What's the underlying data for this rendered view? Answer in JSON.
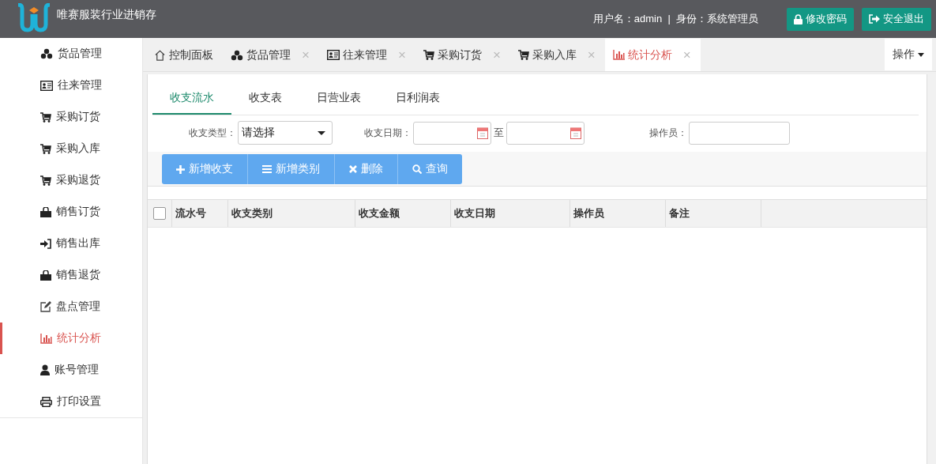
{
  "header": {
    "app_title": "唯赛服装行业进销存",
    "user_info": "用户名：admin  |  身份：系统管理员",
    "buttons": [
      {
        "kind": "lock",
        "label": "修改密码"
      },
      {
        "kind": "logout",
        "label": "安全退出"
      }
    ]
  },
  "sidebar": {
    "items": [
      {
        "kind": "cubes",
        "label": "货品管理",
        "selected": false
      },
      {
        "kind": "card",
        "label": "往来管理",
        "selected": false
      },
      {
        "kind": "cart",
        "label": "采购订货",
        "selected": false
      },
      {
        "kind": "cart",
        "label": "采购入库",
        "selected": false
      },
      {
        "kind": "cart",
        "label": "采购退货",
        "selected": false
      },
      {
        "kind": "bag",
        "label": "销售订货",
        "selected": false
      },
      {
        "kind": "signin",
        "label": "销售出库",
        "selected": false
      },
      {
        "kind": "bag",
        "label": "销售退货",
        "selected": false
      },
      {
        "kind": "edit",
        "label": "盘点管理",
        "selected": false
      },
      {
        "kind": "chart",
        "label": "统计分析",
        "selected": true
      },
      {
        "kind": "user",
        "label": "账号管理",
        "selected": false
      },
      {
        "kind": "print",
        "label": "打印设置",
        "selected": false
      }
    ]
  },
  "tabs": [
    {
      "kind": "home",
      "label": "控制面板",
      "closable": false,
      "selected": false
    },
    {
      "kind": "cubes",
      "label": "货品管理",
      "closable": true,
      "selected": false
    },
    {
      "kind": "card",
      "label": "往来管理",
      "closable": true,
      "selected": false
    },
    {
      "kind": "cart",
      "label": "采购订货",
      "closable": true,
      "selected": false
    },
    {
      "kind": "cart",
      "label": "采购入库",
      "closable": true,
      "selected": false
    },
    {
      "kind": "chart",
      "label": "统计分析",
      "closable": true,
      "selected": true
    }
  ],
  "close_glyph": "×",
  "operations_menu": {
    "label": "操作"
  },
  "subtabs": [
    {
      "label": "收支流水",
      "selected": true
    },
    {
      "label": "收支表",
      "selected": false
    },
    {
      "label": "日营业表",
      "selected": false
    },
    {
      "label": "日利润表",
      "selected": false
    }
  ],
  "filters": {
    "type_label": "收支类型：",
    "type_value": "请选择",
    "date_label": "收支日期：",
    "date_to_label": "至",
    "operator_label": "操作员："
  },
  "toolbar": [
    {
      "kind": "plus",
      "label": "新增收支"
    },
    {
      "kind": "list",
      "label": "新增类别"
    },
    {
      "kind": "times",
      "label": "删除"
    },
    {
      "kind": "search",
      "label": "查询"
    }
  ],
  "table": {
    "select_all": false,
    "columns": [
      "流水号",
      "收支类别",
      "收支金额",
      "收支日期",
      "操作员",
      "备注"
    ]
  }
}
